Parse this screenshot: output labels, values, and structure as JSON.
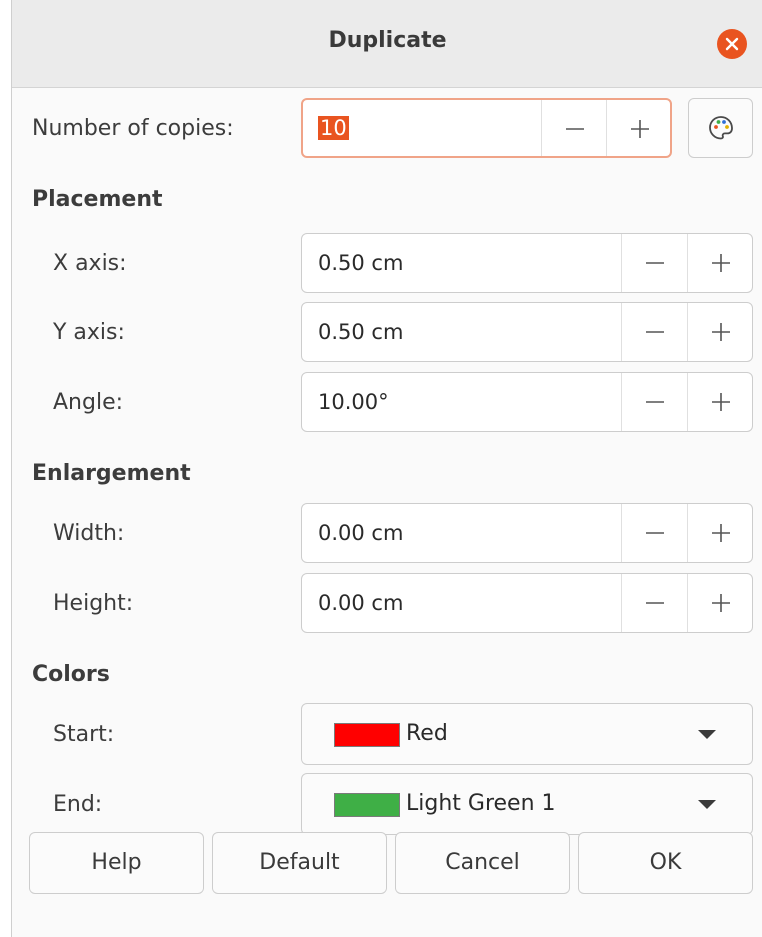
{
  "window": {
    "title": "Duplicate"
  },
  "copies": {
    "label": "Number of copies:",
    "value": "10"
  },
  "placement": {
    "heading": "Placement",
    "x": {
      "label": "X axis:",
      "value": "0.50 cm"
    },
    "y": {
      "label": "Y axis:",
      "value": "0.50 cm"
    },
    "angle": {
      "label": "Angle:",
      "value": "10.00°"
    }
  },
  "enlargement": {
    "heading": "Enlargement",
    "width": {
      "label": "Width:",
      "value": "0.00 cm"
    },
    "height": {
      "label": "Height:",
      "value": "0.00 cm"
    }
  },
  "colors": {
    "heading": "Colors",
    "start": {
      "label": "Start:",
      "value": "Red",
      "swatch": "#ff0000"
    },
    "end": {
      "label": "End:",
      "value": "Light Green 1",
      "swatch": "#3faf46"
    }
  },
  "buttons": {
    "help": "Help",
    "default": "Default",
    "cancel": "Cancel",
    "ok": "OK"
  },
  "icons": {
    "close": "close-icon",
    "palette": "palette-icon",
    "minus": "minus-icon",
    "plus": "plus-icon",
    "dropdown": "chevron-down-icon"
  },
  "accent": "#e95420"
}
